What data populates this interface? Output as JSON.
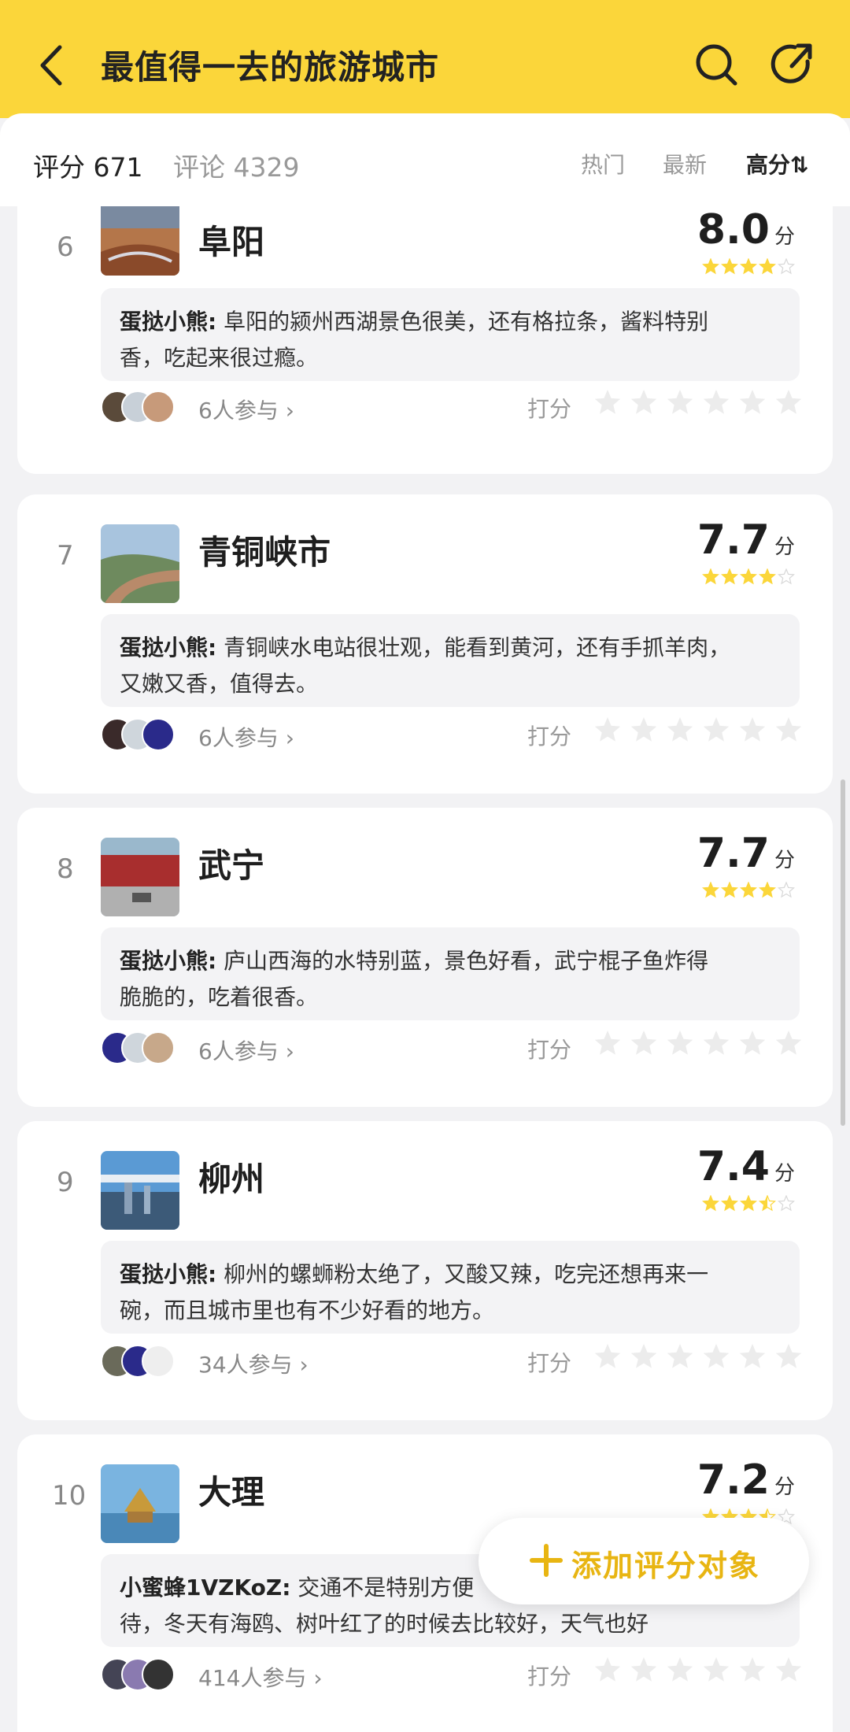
{
  "header": {
    "title": "最值得一去的旅游城市",
    "bg_color": "#fbd63a",
    "back_icon": "back-arrow-icon",
    "search_icon": "search-icon",
    "share_icon": "share-icon"
  },
  "stats": {
    "score": "评分 671",
    "comments": "评论 4329"
  },
  "sort_tabs": [
    "热门",
    "最新",
    "高分⇅"
  ],
  "active_sort": "高分⇅",
  "rate_label": "打分",
  "accent_color": "#fbd63a",
  "items": [
    {
      "rank": "6",
      "city": "阜阳",
      "score": "8.0",
      "unit": "分",
      "stars": 4,
      "author": "蛋挞小熊:",
      "comment_line1": " 阜阳的颍州西湖景色很美，还有格拉条，酱料特别",
      "comment_line2": "香，吃起来很过瘾。",
      "participants": "6人参与",
      "avatars": [
        "#5a4a3a",
        "#c8d0d8",
        "#c79a7a"
      ]
    },
    {
      "rank": "7",
      "city": "青铜峡市",
      "score": "7.7",
      "unit": "分",
      "stars": 4,
      "author": "蛋挞小熊:",
      "comment_line1": " 青铜峡水电站很壮观，能看到黄河，还有手抓羊肉，",
      "comment_line2": "又嫩又香，值得去。",
      "participants": "6人参与",
      "avatars": [
        "#3a2a2a",
        "#cfd6dc",
        "#2a2a8a"
      ]
    },
    {
      "rank": "8",
      "city": "武宁",
      "score": "7.7",
      "unit": "分",
      "stars": 4,
      "author": "蛋挞小熊:",
      "comment_line1": " 庐山西海的水特别蓝，景色好看，武宁棍子鱼炸得",
      "comment_line2": "脆脆的，吃着很香。",
      "participants": "6人参与",
      "avatars": [
        "#2a2a8a",
        "#cfd6dc",
        "#c7a88a"
      ]
    },
    {
      "rank": "9",
      "city": "柳州",
      "score": "7.4",
      "unit": "分",
      "stars": 3.5,
      "author": "蛋挞小熊:",
      "comment_line1": " 柳州的螺蛳粉太绝了，又酸又辣，吃完还想再来一",
      "comment_line2": "碗，而且城市里也有不少好看的地方。",
      "participants": "34人参与",
      "avatars": [
        "#6a6a5a",
        "#2a2a8a",
        "#eeeeee"
      ]
    },
    {
      "rank": "10",
      "city": "大理",
      "score": "7.2",
      "unit": "分",
      "stars": 3.5,
      "author": "小蜜蜂1VZKoZ:",
      "comment_line1": " 交通不是特别方便",
      "comment_line2": "待，冬天有海鸥、树叶红了的时候去比较好，天气也好",
      "participants": "414人参与",
      "avatars": [
        "#445",
        "#8a7ab0",
        "#333"
      ]
    }
  ],
  "fab": {
    "label": "添加评分对象",
    "color": "#e8b512"
  }
}
